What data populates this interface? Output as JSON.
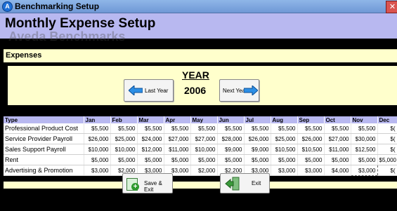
{
  "window": {
    "title": "Benchmarking Setup"
  },
  "header": {
    "title": "Monthly Expense Setup",
    "subtitle": "Aveda Benchmarks"
  },
  "section": {
    "label": "Expenses"
  },
  "year_nav": {
    "year_label": "YEAR",
    "year_value": "2006",
    "prev_label": "Last Year",
    "next_label": "Next Year"
  },
  "table": {
    "headers": [
      "Type",
      "Jan",
      "Feb",
      "Mar",
      "Apr",
      "May",
      "Jun",
      "Jul",
      "Aug",
      "Sep",
      "Oct",
      "Nov",
      "Dec"
    ],
    "rows": [
      [
        "Professional Product Cost",
        "$5,500",
        "$5,500",
        "$5,500",
        "$5,500",
        "$5,500",
        "$5,500",
        "$5,500",
        "$5,500",
        "$5,500",
        "$5,500",
        "$5,500",
        "$("
      ],
      [
        "Service Provider Payroll",
        "$26,000",
        "$25,000",
        "$24,000",
        "$27,000",
        "$27,000",
        "$28,000",
        "$26,000",
        "$25,000",
        "$26,000",
        "$27,000",
        "$30,000",
        "$("
      ],
      [
        "Sales Support Payroll",
        "$10,000",
        "$10,000",
        "$12,000",
        "$11,000",
        "$10,000",
        "$9,000",
        "$9,000",
        "$10,500",
        "$10,500",
        "$11,000",
        "$12,500",
        "$("
      ],
      [
        "Rent",
        "$5,000",
        "$5,000",
        "$5,000",
        "$5,000",
        "$5,000",
        "$5,000",
        "$5,000",
        "$5,000",
        "$5,000",
        "$5,000",
        "$5,000",
        "$5,000"
      ],
      [
        "Advertising & Promotion",
        "$3,000",
        "$2,000",
        "$3,000",
        "$3,000",
        "$2,000",
        "$2,200",
        "$3,000",
        "$3,000",
        "$3,000",
        "$4,000",
        "$3,000",
        "$("
      ]
    ]
  },
  "footer": {
    "save_label": "Save & Exit",
    "exit_label": "Exit"
  }
}
